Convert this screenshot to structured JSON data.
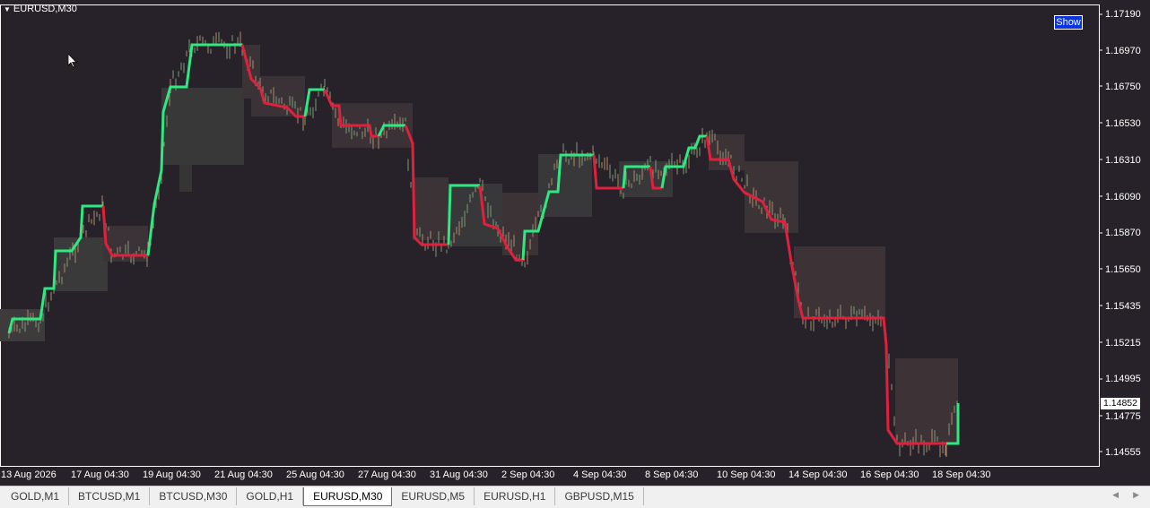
{
  "chart": {
    "symbol": "EURUSD,M30",
    "show_button": "Show",
    "current_price": "1.14852",
    "price_labels": [
      "1.17190",
      "1.16970",
      "1.16750",
      "1.16530",
      "1.16310",
      "1.16090",
      "1.15870",
      "1.15650",
      "1.15435",
      "1.15215",
      "1.14995",
      "1.14775",
      "1.14555"
    ],
    "time_labels": [
      "13 Aug 2026",
      "17 Aug 04:30",
      "19 Aug 04:30",
      "21 Aug 04:30",
      "25 Aug 04:30",
      "27 Aug 04:30",
      "31 Aug 04:30",
      "2 Sep 04:30",
      "4 Sep 04:30",
      "8 Sep 04:30",
      "10 Sep 04:30",
      "14 Sep 04:30",
      "16 Sep 04:30",
      "18 Sep 04:30"
    ]
  },
  "tabs": [
    {
      "label": "GOLD,M1"
    },
    {
      "label": "BTCUSD,M1"
    },
    {
      "label": "BTCUSD,M30"
    },
    {
      "label": "GOLD,H1"
    },
    {
      "label": "EURUSD,M30",
      "active": true
    },
    {
      "label": "EURUSD,M5"
    },
    {
      "label": "EURUSD,H1"
    },
    {
      "label": "GBPUSD,M15"
    }
  ],
  "colors": {
    "background": "#272229",
    "bull": "#2ee880",
    "bear": "#e0203c",
    "box": "#3a3436",
    "axis": "#ffffff"
  },
  "icons": {
    "collapse": "triangle-down-icon",
    "cursor": "mouse-pointer-icon",
    "scroll_left": "arrow-left-icon",
    "scroll_right": "arrow-right-icon"
  }
}
